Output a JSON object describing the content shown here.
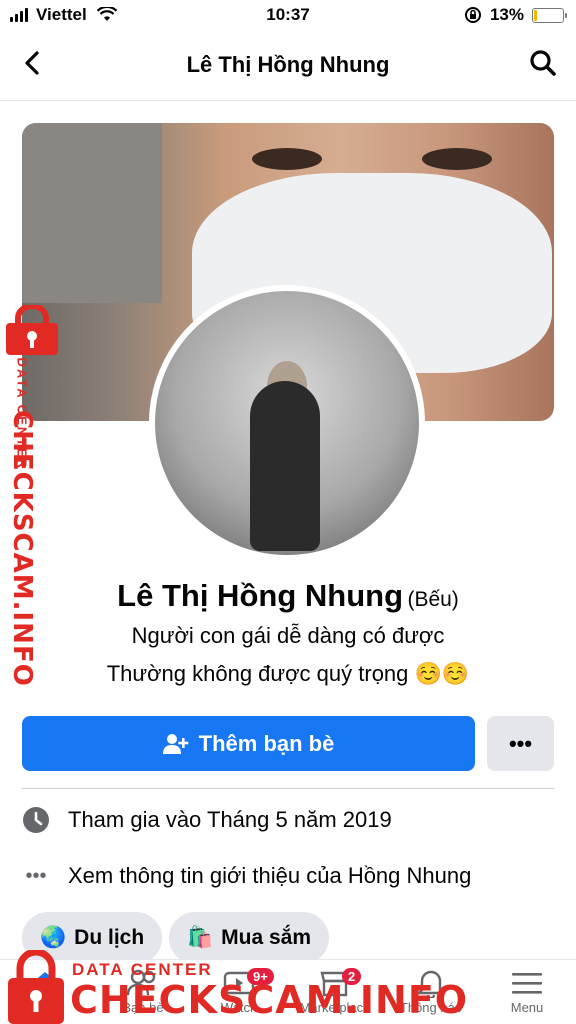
{
  "status_bar": {
    "carrier": "Viettel",
    "time": "10:37",
    "battery": "13%",
    "battery_level": 0.13
  },
  "nav": {
    "title": "Lê Thị Hồng Nhung"
  },
  "profile": {
    "name": "Lê Thị Hồng Nhung",
    "nickname": "(Bếu)",
    "bio_line1": "Người con gái dễ dàng có được",
    "bio_line2": "Thường không được quý trọng ☺️☺️"
  },
  "actions": {
    "add_friend_label": "Thêm bạn bè",
    "more_label": "•••"
  },
  "info": [
    {
      "icon": "clock-icon",
      "text": "Tham gia vào Tháng 5 năm 2019"
    },
    {
      "icon": "more-dots-icon",
      "text": "Xem thông tin giới thiệu của Hồng Nhung"
    }
  ],
  "chips": [
    {
      "emoji": "🌏",
      "label": "Du lịch"
    },
    {
      "emoji": "🛍️",
      "label": "Mua sắm"
    }
  ],
  "tabs": [
    {
      "label": "tin",
      "icon": "home-icon"
    },
    {
      "label": "Bạn bè",
      "icon": "friends-icon"
    },
    {
      "label": "Watch",
      "icon": "watch-icon",
      "badge": "9+"
    },
    {
      "label": "Marketplace",
      "icon": "marketplace-icon",
      "badge": "2"
    },
    {
      "label": "Thông báo",
      "icon": "bell-icon"
    },
    {
      "label": "Menu",
      "icon": "menu-icon"
    }
  ],
  "watermark": {
    "brand": "CHECKSCAM.INFO",
    "tagline": "DATA CENTER"
  },
  "colors": {
    "accent": "#1877f2",
    "watermark": "#e22a24",
    "badge": "#e41e3f"
  }
}
